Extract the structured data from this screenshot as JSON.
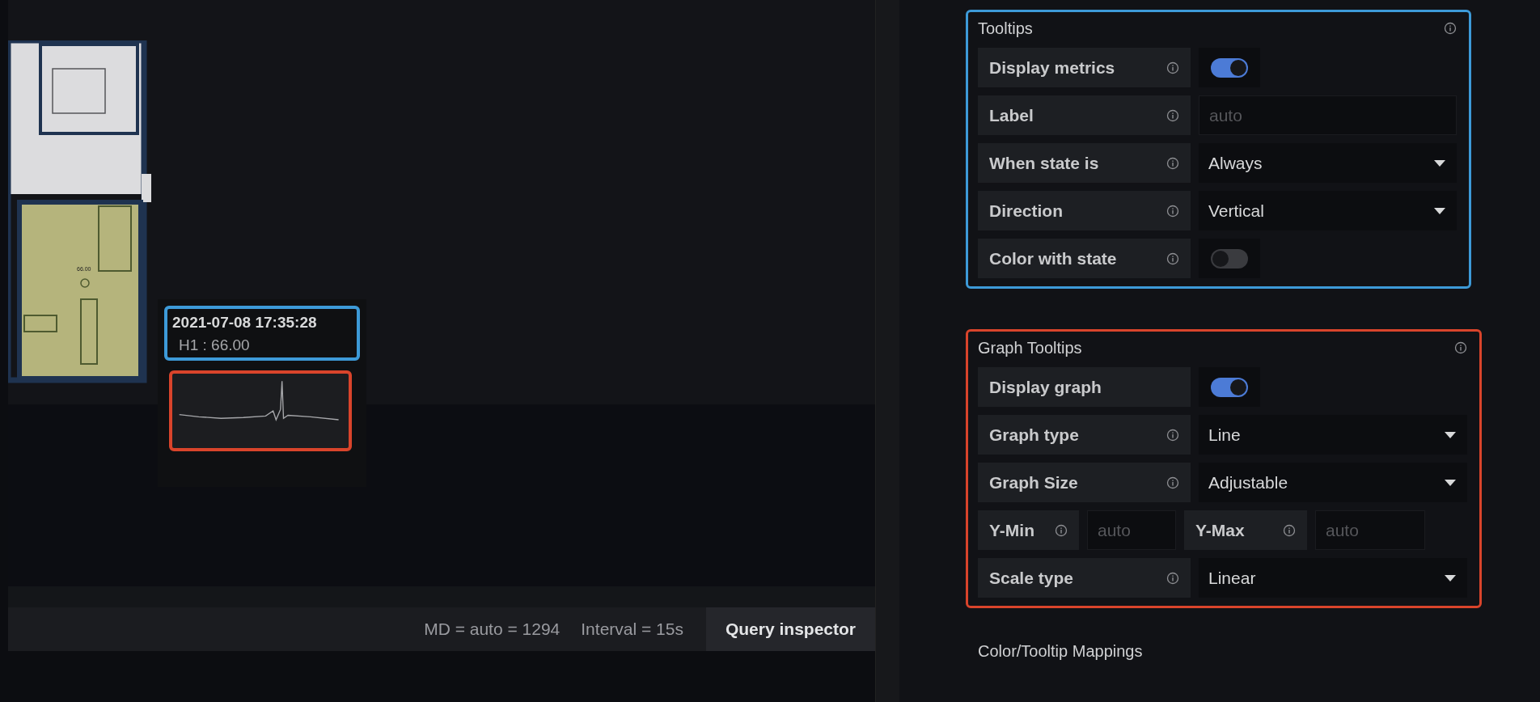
{
  "floor_plan": {
    "room_value": "66.00"
  },
  "tooltip": {
    "time": "2021-07-08 17:35:28",
    "metric": "H1 : 66.00"
  },
  "query_bar": {
    "max_data_points": "MD = auto = 1294",
    "interval": "Interval = 15s",
    "button": "Query inspector"
  },
  "sections": [
    {
      "title": "Tooltips",
      "color": "#3d9ad8",
      "info": true,
      "rows": [
        {
          "kind": "switch",
          "label": "Display metrics",
          "info": true,
          "on": true
        },
        {
          "kind": "input",
          "label": "Label",
          "info": true,
          "placeholder": "auto"
        },
        {
          "kind": "select",
          "label": "When state is",
          "info": true,
          "value": "Always"
        },
        {
          "kind": "select",
          "label": "Direction",
          "info": true,
          "value": "Vertical"
        },
        {
          "kind": "switch",
          "label": "Color with state",
          "info": true,
          "on": false
        }
      ]
    },
    {
      "title": "Graph Tooltips",
      "color": "#d9442b",
      "info": true,
      "rows": [
        {
          "kind": "switch",
          "label": "Display graph",
          "info": false,
          "on": true
        },
        {
          "kind": "select",
          "label": "Graph type",
          "info": true,
          "value": "Line"
        },
        {
          "kind": "select",
          "label": "Graph Size",
          "info": true,
          "value": "Adjustable"
        },
        {
          "kind": "pair",
          "fields": [
            {
              "label": "Y-Min",
              "info": true,
              "placeholder": "auto"
            },
            {
              "label": "Y-Max",
              "info": true,
              "placeholder": "auto"
            }
          ]
        },
        {
          "kind": "select",
          "label": "Scale type",
          "info": true,
          "value": "Linear"
        }
      ]
    },
    {
      "title": "Color/Tooltip Mappings"
    }
  ]
}
